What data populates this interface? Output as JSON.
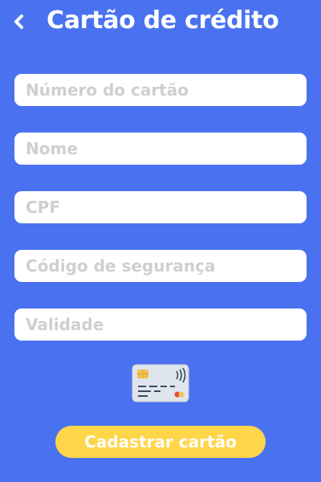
{
  "header": {
    "title": "Cartão de crédito",
    "back_icon": "chevron-left-icon"
  },
  "form": {
    "fields": [
      {
        "placeholder": "Número do cartão",
        "value": ""
      },
      {
        "placeholder": "Nome",
        "value": ""
      },
      {
        "placeholder": "CPF",
        "value": ""
      },
      {
        "placeholder": "Código de segurança",
        "value": ""
      },
      {
        "placeholder": "Validade",
        "value": ""
      }
    ]
  },
  "illustration": {
    "icon": "credit-card-icon"
  },
  "submit_label": "Cadastrar cartão",
  "colors": {
    "background": "#4a72f0",
    "field_background": "#ffffff",
    "placeholder": "#cfcfcf",
    "button": "#ffd54a",
    "button_text": "#ffffff"
  }
}
